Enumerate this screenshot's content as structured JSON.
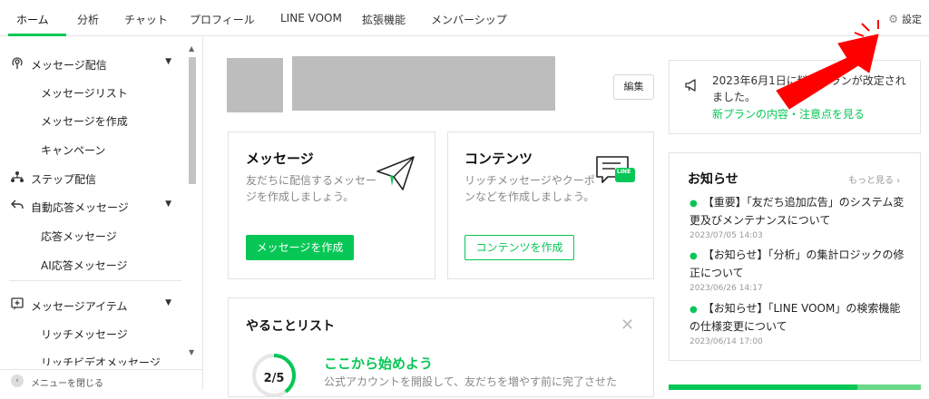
{
  "topnav": {
    "tabs": [
      {
        "label": "ホーム"
      },
      {
        "label": "分析"
      },
      {
        "label": "チャット"
      },
      {
        "label": "プロフィール"
      },
      {
        "label": "LINE VOOM"
      },
      {
        "label": "拡張機能"
      },
      {
        "label": "メンバーシップ"
      }
    ],
    "settings_label": "設定"
  },
  "sidebar": {
    "items": [
      {
        "label": "メッセージ配信",
        "icon": "broadcast-icon"
      },
      {
        "label": "メッセージリスト"
      },
      {
        "label": "メッセージを作成"
      },
      {
        "label": "キャンペーン"
      },
      {
        "label": "ステップ配信",
        "icon": "step-icon"
      },
      {
        "label": "自動応答メッセージ",
        "icon": "reply-icon"
      },
      {
        "label": "応答メッセージ"
      },
      {
        "label": "AI応答メッセージ"
      },
      {
        "label": "メッセージアイテム",
        "icon": "message-item-icon"
      },
      {
        "label": "リッチメッセージ"
      },
      {
        "label": "リッチビデオメッセージ"
      }
    ],
    "footer_label": "メニューを閉じる"
  },
  "header": {
    "edit_label": "編集"
  },
  "cards": {
    "message": {
      "title": "メッセージ",
      "desc": "友だちに配信するメッセージを作成しましょう。",
      "button": "メッセージを作成"
    },
    "content": {
      "title": "コンテンツ",
      "desc": "リッチメッセージやクーポンなどを作成しましょう。",
      "button": "コンテンツを作成",
      "badge": "LINE"
    }
  },
  "todo": {
    "title": "やることリスト",
    "progress_text": "2/5",
    "progress_fraction": 0.4,
    "heading": "ここから始めよう",
    "desc": "公式アカウントを開設して、友だちを増やす前に完了させた"
  },
  "notice": {
    "text": "2023年6月1日に料金プランが改定されました。",
    "link": "新プランの内容・注意点を見る"
  },
  "news": {
    "title": "お知らせ",
    "more": "もっと見る ›",
    "items": [
      {
        "text": "【重要】「友だち追加広告」のシステム変更及びメンテナンスについて",
        "date": "2023/07/05 14:03"
      },
      {
        "text": "【お知らせ】「分析」の集計ロジックの修正について",
        "date": "2023/06/26 14:17"
      },
      {
        "text": "【お知らせ】「LINE VOOM」の検索機能の仕様変更について",
        "date": "2023/06/14 17:00"
      }
    ]
  },
  "colors": {
    "accent": "#06c755",
    "annotation_arrow": "#ff0000"
  }
}
